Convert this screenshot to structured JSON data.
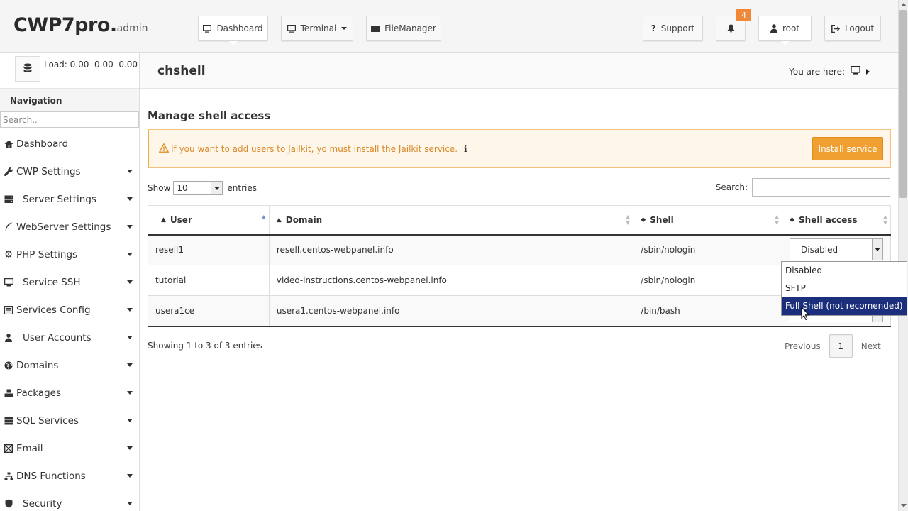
{
  "header": {
    "brand": "CWP7pro.",
    "brand_suffix": "admin",
    "buttons": {
      "dashboard": "Dashboard",
      "terminal": "Terminal",
      "filemanager": "FileManager",
      "support": "Support",
      "user": "root",
      "logout": "Logout"
    },
    "notifications_count": "4"
  },
  "sidebar": {
    "load_text": "Load: 0.00  0.00  0.00",
    "nav_title": "Navigation",
    "search_placeholder": "Search..",
    "items": [
      {
        "label": "Dashboard",
        "icon": "home-icon",
        "has_submenu": false
      },
      {
        "label": "CWP Settings",
        "icon": "tools-icon",
        "has_submenu": true
      },
      {
        "label": "Server Settings",
        "icon": "server-icon",
        "has_submenu": true
      },
      {
        "label": "WebServer Settings",
        "icon": "feather-icon",
        "has_submenu": true
      },
      {
        "label": "PHP Settings",
        "icon": "gear-icon",
        "has_submenu": true
      },
      {
        "label": "Service SSH",
        "icon": "monitor-icon",
        "has_submenu": true
      },
      {
        "label": "Services Config",
        "icon": "list-icon",
        "has_submenu": true
      },
      {
        "label": "User Accounts",
        "icon": "user-icon",
        "has_submenu": true
      },
      {
        "label": "Domains",
        "icon": "globe-icon",
        "has_submenu": true
      },
      {
        "label": "Packages",
        "icon": "cubes-icon",
        "has_submenu": true
      },
      {
        "label": "SQL Services",
        "icon": "database-icon",
        "has_submenu": true
      },
      {
        "label": "Email",
        "icon": "envelope-icon",
        "has_submenu": true
      },
      {
        "label": "DNS Functions",
        "icon": "sitemap-icon",
        "has_submenu": true
      },
      {
        "label": "Security",
        "icon": "shield-icon",
        "has_submenu": true
      }
    ]
  },
  "page": {
    "title": "chshell",
    "breadcrumb_label": "You are here:",
    "section_title": "Manage shell access",
    "alert_text": "If you want to add users to Jailkit, yo must install the Jailkit service.",
    "install_button": "Install service",
    "show_label": "Show",
    "entries_label": "entries",
    "page_size": "10",
    "search_label": "Search:",
    "columns": [
      "User",
      "Domain",
      "Shell",
      "Shell access"
    ],
    "rows": [
      {
        "user": "resell1",
        "domain": "resell.centos-webpanel.info",
        "shell": "/sbin/nologin"
      },
      {
        "user": "tutorial",
        "domain": "video-instructions.centos-webpanel.info",
        "shell": "/sbin/nologin"
      },
      {
        "user": "usera1ce",
        "domain": "usera1.centos-webpanel.info",
        "shell": "/bin/bash"
      }
    ],
    "shell_select_value": "Disabled",
    "dropdown_options": [
      "Disabled",
      "SFTP",
      "Full Shell (not recomended)"
    ],
    "dropdown_highlighted": 2,
    "info_text": "Showing 1 to 3 of 3 entries",
    "pager": {
      "previous": "Previous",
      "current": "1",
      "next": "Next"
    }
  },
  "colors": {
    "accent_orange": "#f0a030",
    "alert_text": "#d9892a",
    "highlight": "#1c2f7d"
  }
}
